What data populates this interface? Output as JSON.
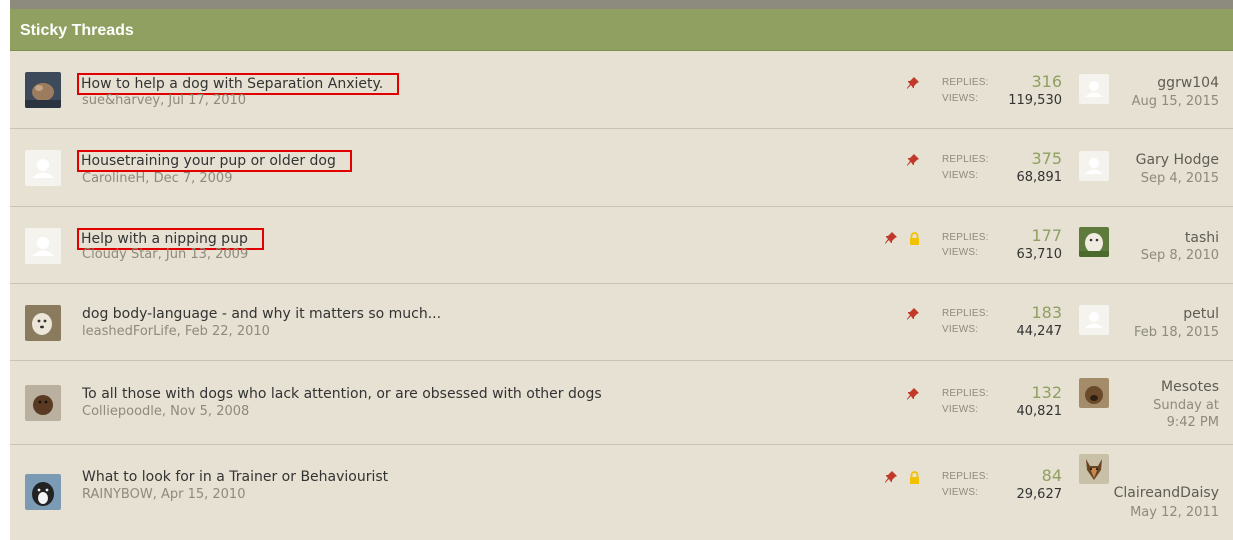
{
  "section": {
    "title": "Sticky Threads"
  },
  "labels": {
    "replies": "REPLIES:",
    "views": "VIEWS:"
  },
  "colors": {
    "header_bg": "#8fa060",
    "row_bg": "#e6e1d2",
    "replies_color": "#8fa060",
    "highlight_box": "#e00000",
    "pin": "#c0392b",
    "lock": "#f2c200"
  },
  "threads": [
    {
      "title": "How to help a dog with Separation Anxiety.",
      "author": "sue&harvey",
      "date": "Jul 17, 2010",
      "replies": "316",
      "views": "119,530",
      "last_user": "ggrw104",
      "last_date": "Aug 15, 2015",
      "icons": [
        "pin-icon"
      ]
    },
    {
      "title": "Housetraining your pup or older dog",
      "author": "CarolineH",
      "date": "Dec 7, 2009",
      "replies": "375",
      "views": "68,891",
      "last_user": "Gary Hodge",
      "last_date": "Sep 4, 2015",
      "icons": [
        "pin-icon"
      ]
    },
    {
      "title": "Help with a nipping pup",
      "author": "Cloudy Star",
      "date": "Jun 13, 2009",
      "replies": "177",
      "views": "63,710",
      "last_user": "tashi",
      "last_date": "Sep 8, 2010",
      "icons": [
        "pin-icon",
        "lock-icon"
      ]
    },
    {
      "title": "dog body-language - and why it matters so much...",
      "author": "leashedForLife",
      "date": "Feb 22, 2010",
      "replies": "183",
      "views": "44,247",
      "last_user": "petul",
      "last_date": "Feb 18, 2015",
      "icons": [
        "pin-icon"
      ]
    },
    {
      "title": "To all those with dogs who lack attention, or are obsessed with other dogs",
      "author": "Colliepoodle",
      "date": "Nov 5, 2008",
      "replies": "132",
      "views": "40,821",
      "last_user": "Mesotes",
      "last_date": "Sunday at 9:42 PM",
      "icons": [
        "pin-icon"
      ]
    },
    {
      "title": "What to look for in a Trainer or Behaviourist",
      "author": "RAINYBOW",
      "date": "Apr 15, 2010",
      "replies": "84",
      "views": "29,627",
      "last_user": "ClaireandDaisy",
      "last_date": "May 12, 2011",
      "icons": [
        "pin-icon",
        "lock-icon"
      ]
    }
  ]
}
